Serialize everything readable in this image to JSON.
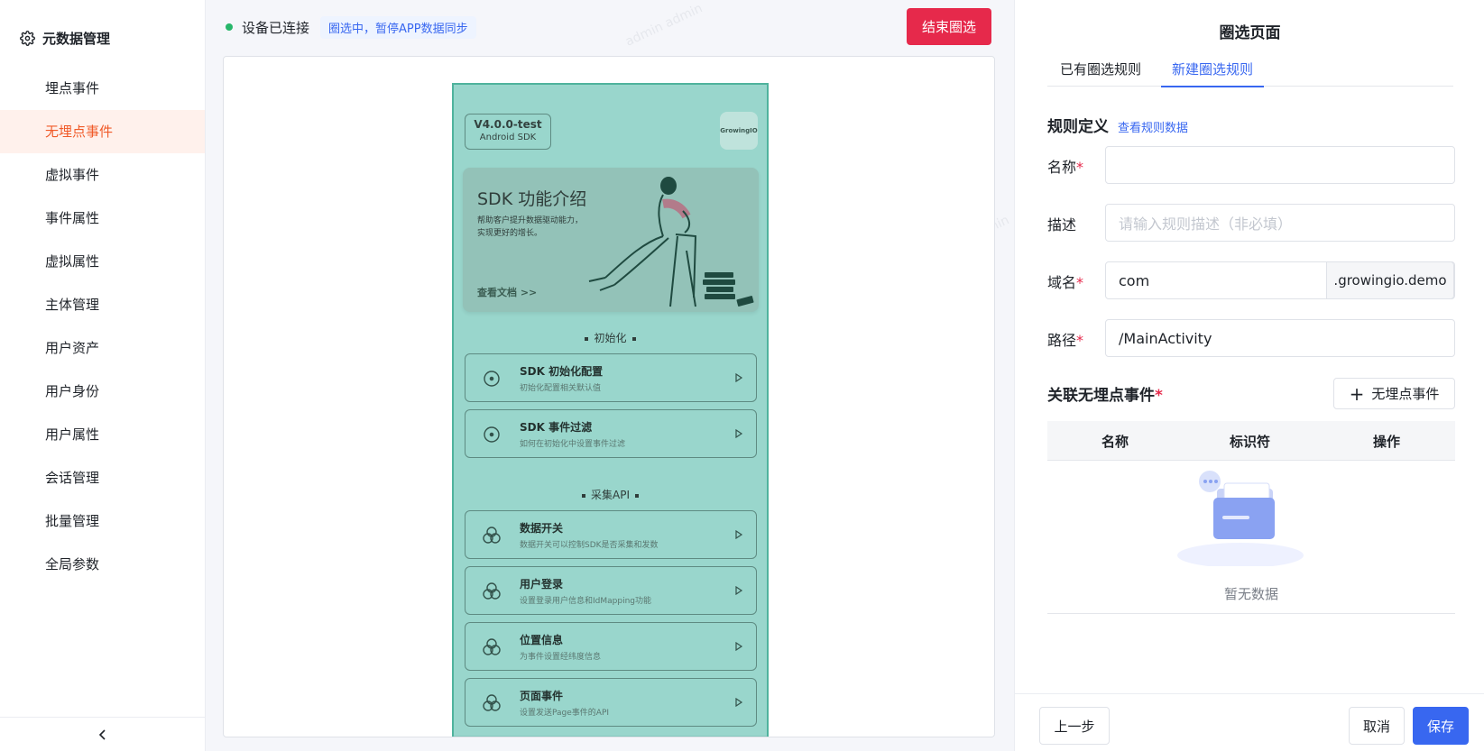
{
  "sidebar": {
    "title": "元数据管理",
    "items": [
      {
        "label": "埋点事件"
      },
      {
        "label": "无埋点事件"
      },
      {
        "label": "虚拟事件"
      },
      {
        "label": "事件属性"
      },
      {
        "label": "虚拟属性"
      },
      {
        "label": "主体管理"
      },
      {
        "label": "用户资产"
      },
      {
        "label": "用户身份"
      },
      {
        "label": "用户属性"
      },
      {
        "label": "会话管理"
      },
      {
        "label": "批量管理"
      },
      {
        "label": "全局参数"
      }
    ],
    "active_index": 1,
    "collapse_icon": "chevron-left-icon"
  },
  "status": {
    "connected_text": "设备已连接",
    "tag": "圈选中，暂停APP数据同步",
    "end_button": "结束圈选",
    "dot_color": "#27b66a",
    "end_color": "#e6294b"
  },
  "phone": {
    "version": "V4.0.0-test",
    "platform": "Android SDK",
    "logo": "GrowingIO",
    "hero_title": "SDK 功能介绍",
    "hero_desc": "帮助客户提升数据驱动能力，实现更好的增长。",
    "hero_link": "查看文档 >>",
    "section_init": "初始化",
    "section_api": "采集API",
    "rows": [
      {
        "title": "SDK 初始化配置",
        "sub": "初始化配置相关默认值"
      },
      {
        "title": "SDK 事件过滤",
        "sub": "如何在初始化中设置事件过滤"
      },
      {
        "title": "数据开关",
        "sub": "数据开关可以控制SDK是否采集和发数"
      },
      {
        "title": "用户登录",
        "sub": "设置登录用户信息和IdMapping功能"
      },
      {
        "title": "位置信息",
        "sub": "为事件设置经纬度信息"
      },
      {
        "title": "页面事件",
        "sub": "设置发送Page事件的API"
      }
    ]
  },
  "panel": {
    "title": "圈选页面",
    "tabs": [
      {
        "label": "已有圈选规则"
      },
      {
        "label": "新建圈选规则"
      }
    ],
    "active_tab": 1,
    "rule_title": "规则定义",
    "rule_link": "查看规则数据",
    "fields": {
      "name": {
        "label": "名称",
        "value": ""
      },
      "desc": {
        "label": "描述",
        "placeholder": "请输入规则描述（非必填）"
      },
      "domain": {
        "label": "域名",
        "value": "com",
        "suffix": ".growingio.demo"
      },
      "path": {
        "label": "路径",
        "value": "/MainActivity"
      }
    },
    "required_mark": "*",
    "assoc_title": "关联无埋点事件",
    "add_button": "无埋点事件",
    "table_headers": [
      "名称",
      "标识符",
      "操作"
    ],
    "empty_text": "暂无数据",
    "prev_button": "上一步",
    "cancel_button": "取消",
    "save_button": "保存",
    "accent": "#3867f0"
  }
}
